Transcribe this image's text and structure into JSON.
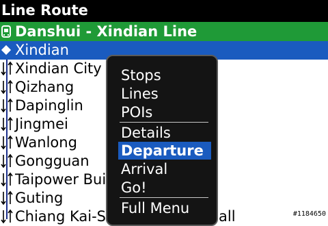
{
  "screen": {
    "title": "Line Route"
  },
  "line": {
    "name": "Danshui - Xindian Line",
    "icon": "bus-icon",
    "color": "#1f9a37"
  },
  "stops": [
    {
      "name": "Xindian"
    },
    {
      "name": "Xindian City Hall"
    },
    {
      "name": "Qizhang"
    },
    {
      "name": "Dapinglin"
    },
    {
      "name": "Jingmei"
    },
    {
      "name": "Wanlong"
    },
    {
      "name": "Gongguan"
    },
    {
      "name": "Taipower Building"
    },
    {
      "name": "Guting"
    },
    {
      "name": "Chiang Kai-Shek Memorial Hall"
    }
  ],
  "menu": {
    "items": [
      {
        "label": "Stops"
      },
      {
        "label": "Lines"
      },
      {
        "label": "POIs"
      },
      {
        "label": "Details"
      },
      {
        "label": "Departure"
      },
      {
        "label": "Arrival"
      },
      {
        "label": "Go!"
      },
      {
        "label": "Full Menu"
      }
    ],
    "selected": "Departure"
  },
  "watermark": "#1184650",
  "colors": {
    "selection": "#1a5bbf",
    "titlebar": "#000000",
    "route_line": "#1a2e8a"
  }
}
